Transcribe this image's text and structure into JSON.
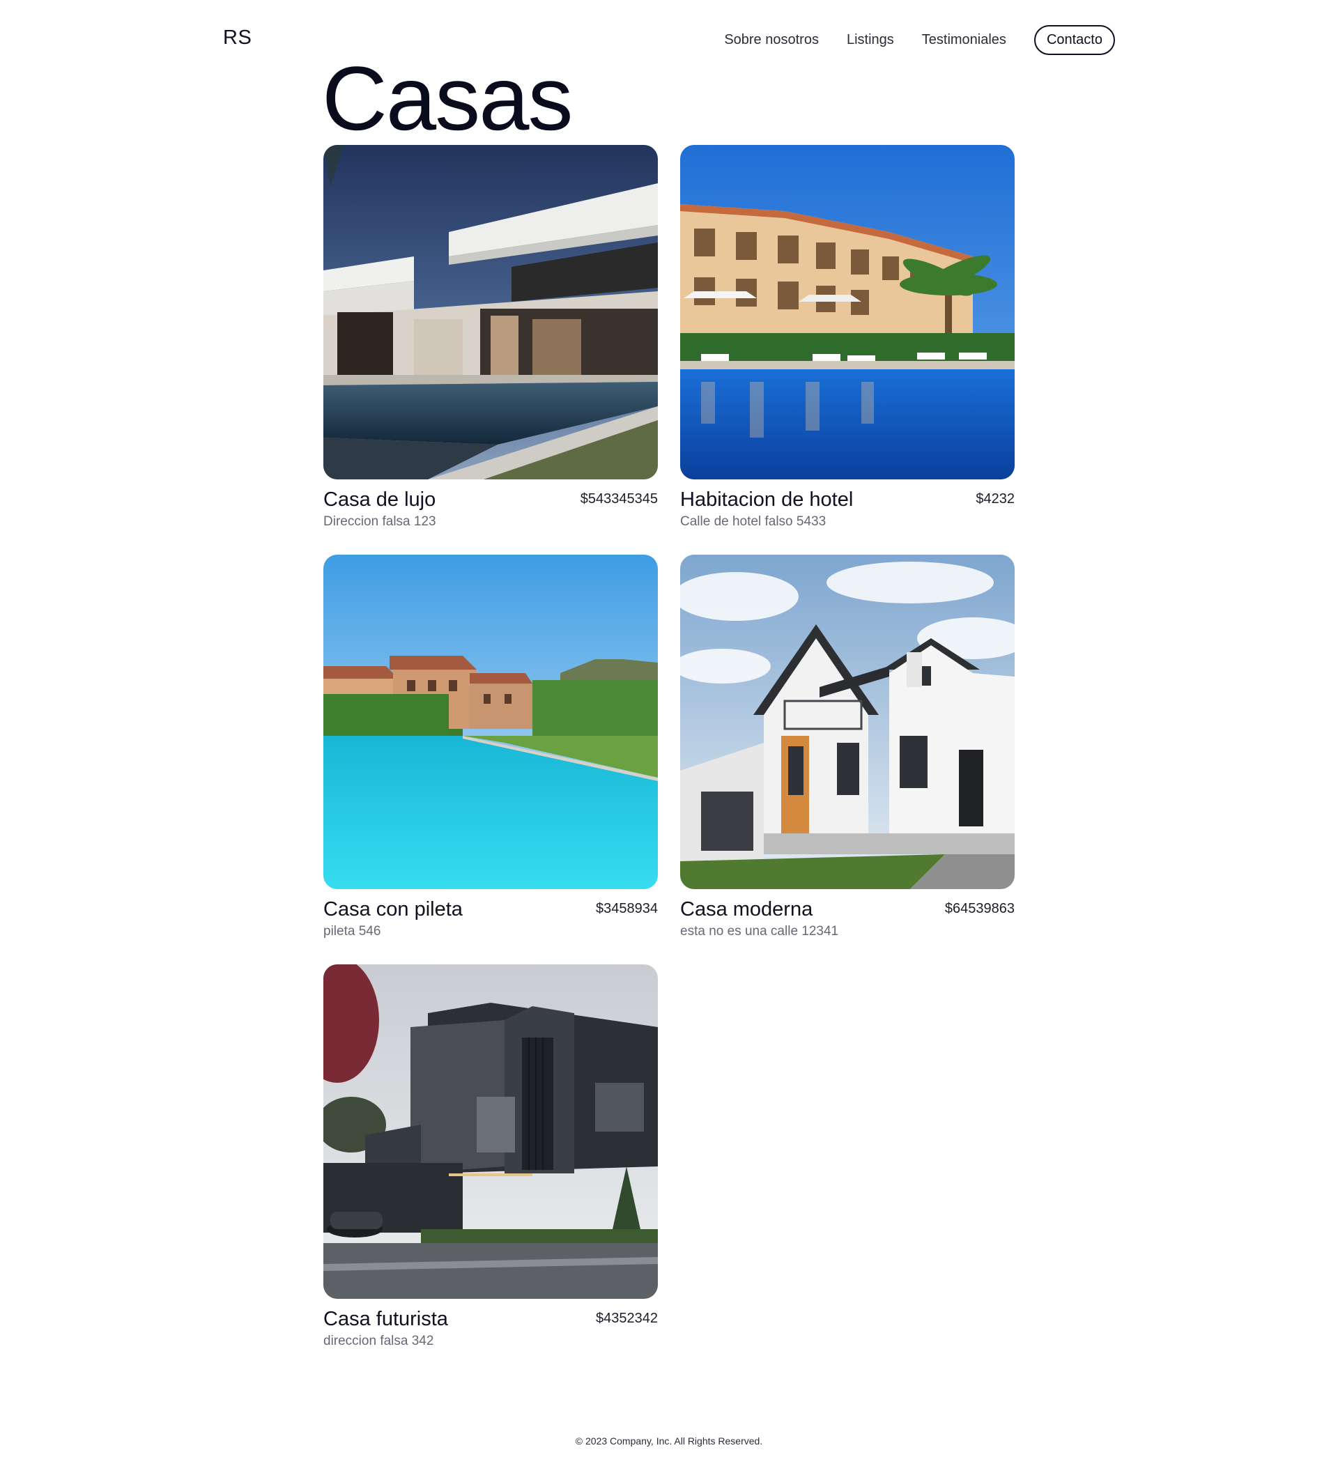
{
  "header": {
    "logo": "RS",
    "nav": [
      "Sobre nosotros",
      "Listings",
      "Testimoniales"
    ],
    "contact_label": "Contacto"
  },
  "main": {
    "title": "Casas",
    "listings": [
      {
        "title": "Casa de lujo",
        "price": "$543345345",
        "address": "Direccion falsa 123",
        "image": "luxury-villa-pool-photo"
      },
      {
        "title": "Habitacion de hotel",
        "price": "$4232",
        "address": "Calle de hotel falso 5433",
        "image": "hotel-pool-photo"
      },
      {
        "title": "Casa con pileta",
        "price": "$3458934",
        "address": "pileta 546",
        "image": "villa-infinity-pool-photo"
      },
      {
        "title": "Casa moderna",
        "price": "$64539863",
        "address": "esta no es una calle 12341",
        "image": "modern-white-house-photo"
      },
      {
        "title": "Casa futurista",
        "price": "$4352342",
        "address": "direccion falsa 342",
        "image": "futuristic-dark-house-photo"
      }
    ]
  },
  "footer": {
    "copyright": "© 2023 Company, Inc. All Rights Reserved."
  },
  "colors": {
    "text": "#0f1020",
    "muted": "#666877",
    "background": "#ffffff"
  }
}
